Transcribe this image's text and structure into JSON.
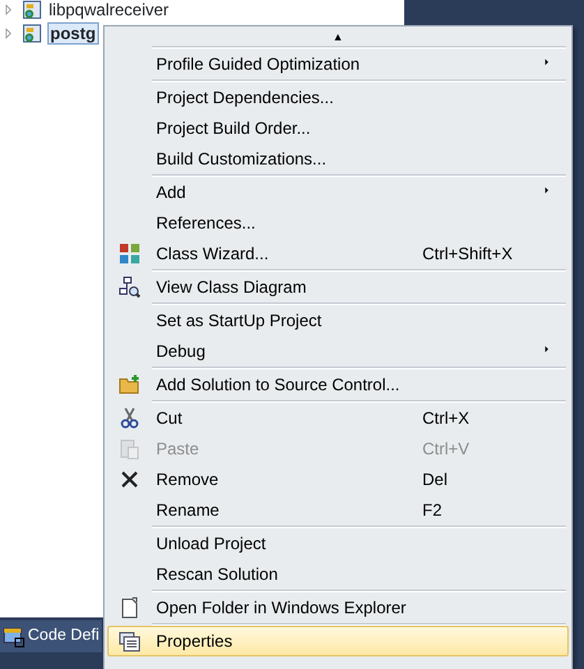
{
  "tree": [
    {
      "label": "libpqwalreceiver",
      "selected": false
    },
    {
      "label": "postg",
      "selected": true
    }
  ],
  "bottom_tab": {
    "label": "Code Defi"
  },
  "context_menu": {
    "scroll_up": "▲",
    "groups": [
      [
        {
          "label": "Profile Guided Optimization",
          "submenu": true,
          "disabled": false,
          "selected": false
        }
      ],
      [
        {
          "label": "Project Dependencies...",
          "submenu": false,
          "disabled": false,
          "selected": false
        },
        {
          "label": "Project Build Order...",
          "submenu": false,
          "disabled": false,
          "selected": false
        },
        {
          "label": "Build Customizations...",
          "submenu": false,
          "disabled": false,
          "selected": false
        }
      ],
      [
        {
          "label": "Add",
          "submenu": true,
          "disabled": false,
          "selected": false
        },
        {
          "label": "References...",
          "submenu": false,
          "disabled": false,
          "selected": false
        },
        {
          "label": "Class Wizard...",
          "kind": "wizard",
          "shortcut": "Ctrl+Shift+X",
          "submenu": false,
          "disabled": false,
          "selected": false
        }
      ],
      [
        {
          "label": "View Class Diagram",
          "kind": "diagram",
          "submenu": false,
          "disabled": false,
          "selected": false
        }
      ],
      [
        {
          "label": "Set as StartUp Project",
          "submenu": false,
          "disabled": false,
          "selected": false
        },
        {
          "label": "Debug",
          "submenu": true,
          "disabled": false,
          "selected": false
        }
      ],
      [
        {
          "label": "Add Solution to Source Control...",
          "kind": "folder-add",
          "submenu": false,
          "disabled": false,
          "selected": false
        }
      ],
      [
        {
          "label": "Cut",
          "kind": "cut",
          "shortcut": "Ctrl+X",
          "submenu": false,
          "disabled": false,
          "selected": false
        },
        {
          "label": "Paste",
          "kind": "paste",
          "shortcut": "Ctrl+V",
          "submenu": false,
          "disabled": true,
          "selected": false
        },
        {
          "label": "Remove",
          "kind": "remove",
          "shortcut": "Del",
          "submenu": false,
          "disabled": false,
          "selected": false
        },
        {
          "label": "Rename",
          "shortcut": "F2",
          "submenu": false,
          "disabled": false,
          "selected": false
        }
      ],
      [
        {
          "label": "Unload Project",
          "submenu": false,
          "disabled": false,
          "selected": false
        },
        {
          "label": "Rescan Solution",
          "submenu": false,
          "disabled": false,
          "selected": false
        }
      ],
      [
        {
          "label": "Open Folder in Windows Explorer",
          "kind": "document",
          "submenu": false,
          "disabled": false,
          "selected": false
        }
      ],
      [
        {
          "label": "Properties",
          "kind": "properties",
          "submenu": false,
          "disabled": false,
          "selected": true
        }
      ]
    ]
  }
}
